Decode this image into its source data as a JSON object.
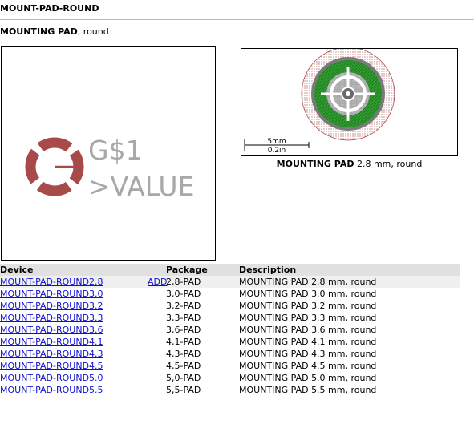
{
  "page": {
    "title": "MOUNT-PAD-ROUND",
    "subtitle_bold": "MOUNTING PAD",
    "subtitle_rest": ", round"
  },
  "symbol": {
    "name_label": "G$1",
    "value_label": ">VALUE",
    "pad_color": "#a84a4a",
    "text_color": "#a8a8a8"
  },
  "package_preview": {
    "caption_bold": "MOUNTING PAD",
    "caption_rest": " 2.8 mm, round",
    "scale_top": "5mm",
    "scale_bottom": "0.2in",
    "copper_color": "#2e9b2e",
    "keepout_color": "#a84a4a"
  },
  "table": {
    "headers": {
      "device": "Device",
      "package": "Package",
      "description": "Description"
    },
    "add_label": "ADD",
    "rows": [
      {
        "device": "MOUNT-PAD-ROUND2.8",
        "package": "2,8-PAD",
        "description": "MOUNTING PAD 2.8 mm, round"
      },
      {
        "device": "MOUNT-PAD-ROUND3.0",
        "package": "3,0-PAD",
        "description": "MOUNTING PAD 3.0 mm, round"
      },
      {
        "device": "MOUNT-PAD-ROUND3.2",
        "package": "3,2-PAD",
        "description": "MOUNTING PAD 3.2 mm, round"
      },
      {
        "device": "MOUNT-PAD-ROUND3.3",
        "package": "3,3-PAD",
        "description": "MOUNTING PAD 3.3 mm, round"
      },
      {
        "device": "MOUNT-PAD-ROUND3.6",
        "package": "3,6-PAD",
        "description": "MOUNTING PAD 3.6 mm, round"
      },
      {
        "device": "MOUNT-PAD-ROUND4.1",
        "package": "4,1-PAD",
        "description": "MOUNTING PAD 4.1 mm, round"
      },
      {
        "device": "MOUNT-PAD-ROUND4.3",
        "package": "4,3-PAD",
        "description": "MOUNTING PAD 4.3 mm, round"
      },
      {
        "device": "MOUNT-PAD-ROUND4.5",
        "package": "4,5-PAD",
        "description": "MOUNTING PAD 4.5 mm, round"
      },
      {
        "device": "MOUNT-PAD-ROUND5.0",
        "package": "5,0-PAD",
        "description": "MOUNTING PAD 5.0 mm, round"
      },
      {
        "device": "MOUNT-PAD-ROUND5.5",
        "package": "5,5-PAD",
        "description": "MOUNTING PAD 5.5 mm, round"
      }
    ]
  }
}
